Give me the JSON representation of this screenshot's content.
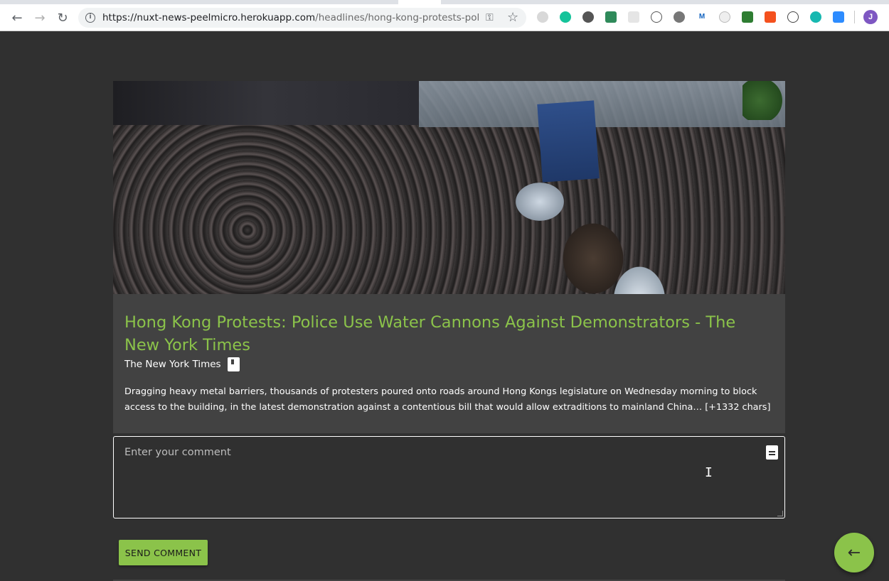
{
  "browser": {
    "url_host": "https://nuxt-news-peelmicro.herokuapp.com",
    "url_path": "/headlines/hong-kong-protests-police...",
    "profile_initial": "J",
    "extension_icons": [
      "wave-icon",
      "grammarly-icon",
      "circle-icon",
      "vue-devtools-icon",
      "grid-icon",
      "code-icon",
      "moon-icon",
      "m-icon",
      "timer-icon",
      "green-square-icon",
      "orange-square-icon",
      "link-icon",
      "teal-circle-icon",
      "zoom-icon"
    ]
  },
  "article": {
    "title": "Hong Kong Protests: Police Use Water Cannons Against Demonstrators - The New York Times",
    "source": "The New York Times",
    "description": "Dragging heavy metal barriers, thousands of protesters poured onto roads around Hong Kongs legislature on Wednesday morning to block access to the building, in the latest demonstration against a contentious bill that would allow extraditions to mainland China… [+1332 chars]"
  },
  "comment": {
    "placeholder": "Enter your comment",
    "value": ""
  },
  "actions": {
    "send_label": "SEND COMMENT"
  },
  "colors": {
    "accent": "#8bc34a",
    "background": "#303030",
    "card": "#424242"
  }
}
